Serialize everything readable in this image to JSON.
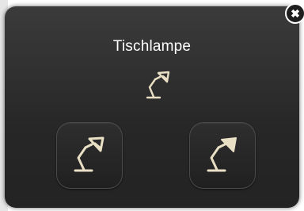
{
  "dialog": {
    "title": "Tischlampe",
    "close_label": "✖"
  },
  "icons": {
    "status": "desk-lamp-icon",
    "off_button": "desk-lamp-off-icon",
    "on_button": "desk-lamp-on-icon",
    "close": "close-icon"
  },
  "colors": {
    "dialog_background": "#2a2a2a",
    "lamp_icon": "#e9dfc4",
    "title_text": "#ffffff"
  }
}
